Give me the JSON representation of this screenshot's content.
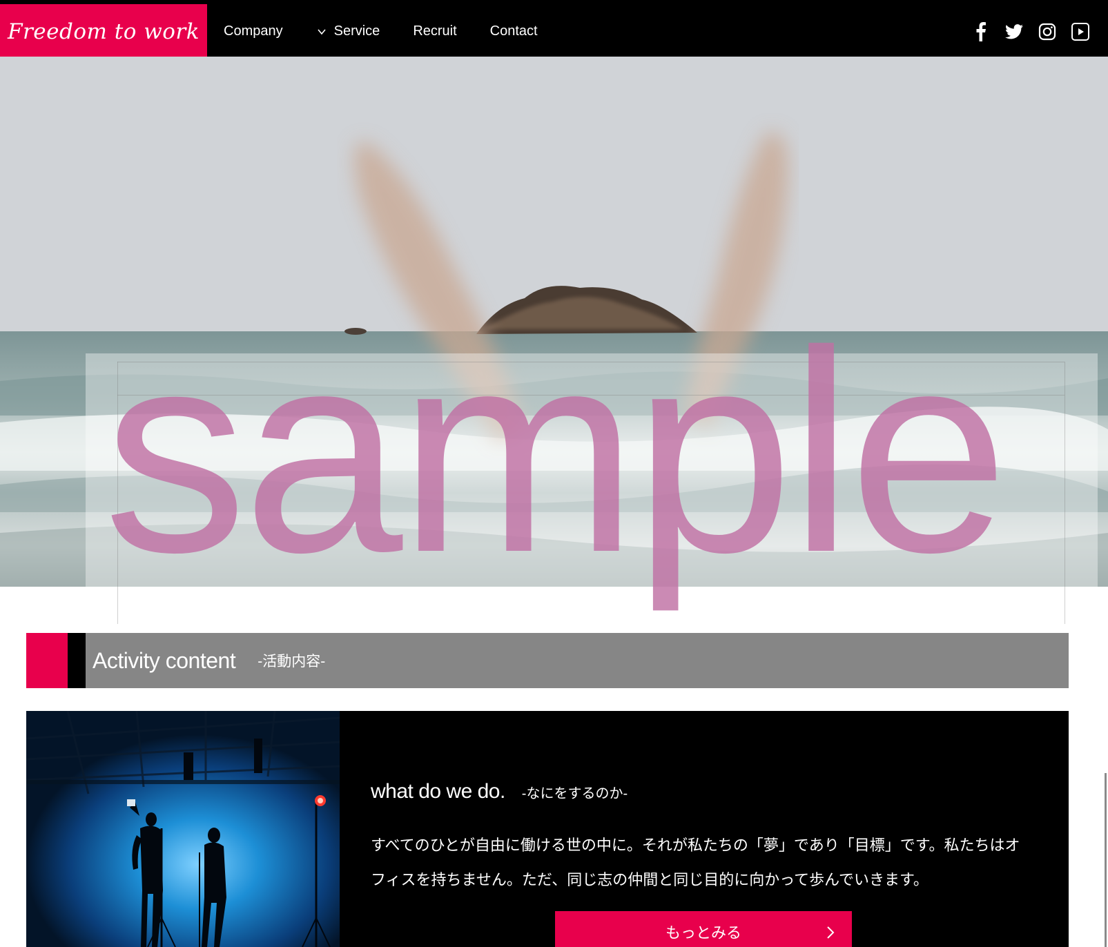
{
  "header": {
    "logo_text": "Freedom to work",
    "nav": [
      {
        "label": "Company"
      },
      {
        "label": "Service",
        "has_dropdown": true
      },
      {
        "label": "Recruit"
      },
      {
        "label": "Contact"
      }
    ],
    "social_icons": [
      "facebook-icon",
      "twitter-icon",
      "instagram-icon",
      "youtube-icon"
    ]
  },
  "hero": {
    "watermark": "sample"
  },
  "section": {
    "title": "Activity content",
    "subtitle": "-活動内容-"
  },
  "feature": {
    "heading": "what do we do.",
    "heading_sub": "-なにをするのか-",
    "body": "すべてのひとが自由に働ける世の中に。それが私たちの「夢」であり「目標」です。私たちはオフィスを持ちません。ただ、同じ志の仲間と同じ目的に向かって歩んでいきます。",
    "button_label": "もっとみる"
  },
  "colors": {
    "accent": "#e8004c",
    "header_bg": "#000000",
    "section_bar": "#868686",
    "watermark": "#c070a4"
  }
}
